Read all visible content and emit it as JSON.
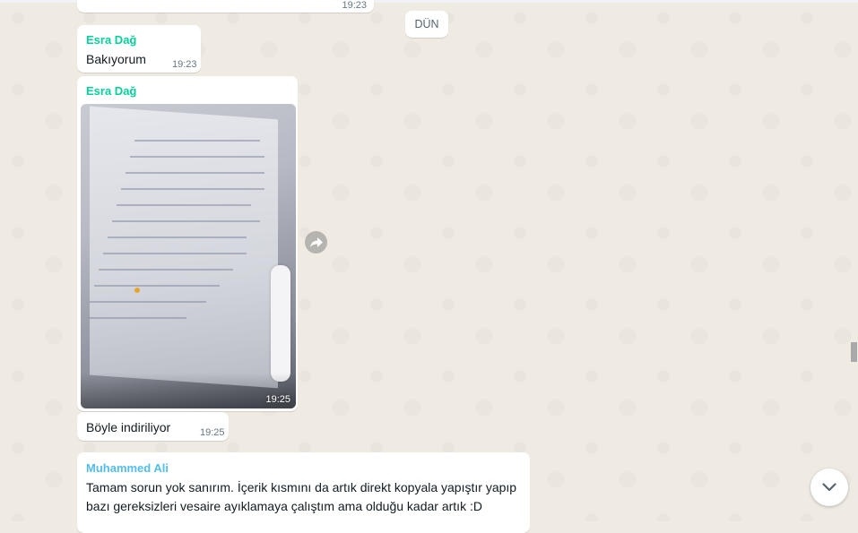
{
  "date_separator": "DÜN",
  "previous_message": {
    "time": "19:23"
  },
  "messages": [
    {
      "sender": "Esra Dağ",
      "text": "Bakıyorum",
      "time": "19:23"
    },
    {
      "sender": "Esra Dağ",
      "type": "image",
      "time": "19:25"
    },
    {
      "text": "Böyle indiriliyor",
      "time": "19:25"
    },
    {
      "sender": "Muhammed Ali",
      "text_line1": "Tamam sorun yok sanırım. İçerik kısmını da artık direkt kopyala yapıştır yapıp",
      "text_line2": "bazı gereksizleri vesaire ayıklamaya çalıştım ama olduğu kadar artık :D"
    }
  ],
  "icons": {
    "forward": "forward-icon",
    "scroll_down": "chevron-down-icon"
  },
  "colors": {
    "wallpaper": "#efeae2",
    "bubble": "#ffffff",
    "sender_esra": "#06cf9c",
    "sender_muhammed": "#53bdeb"
  }
}
